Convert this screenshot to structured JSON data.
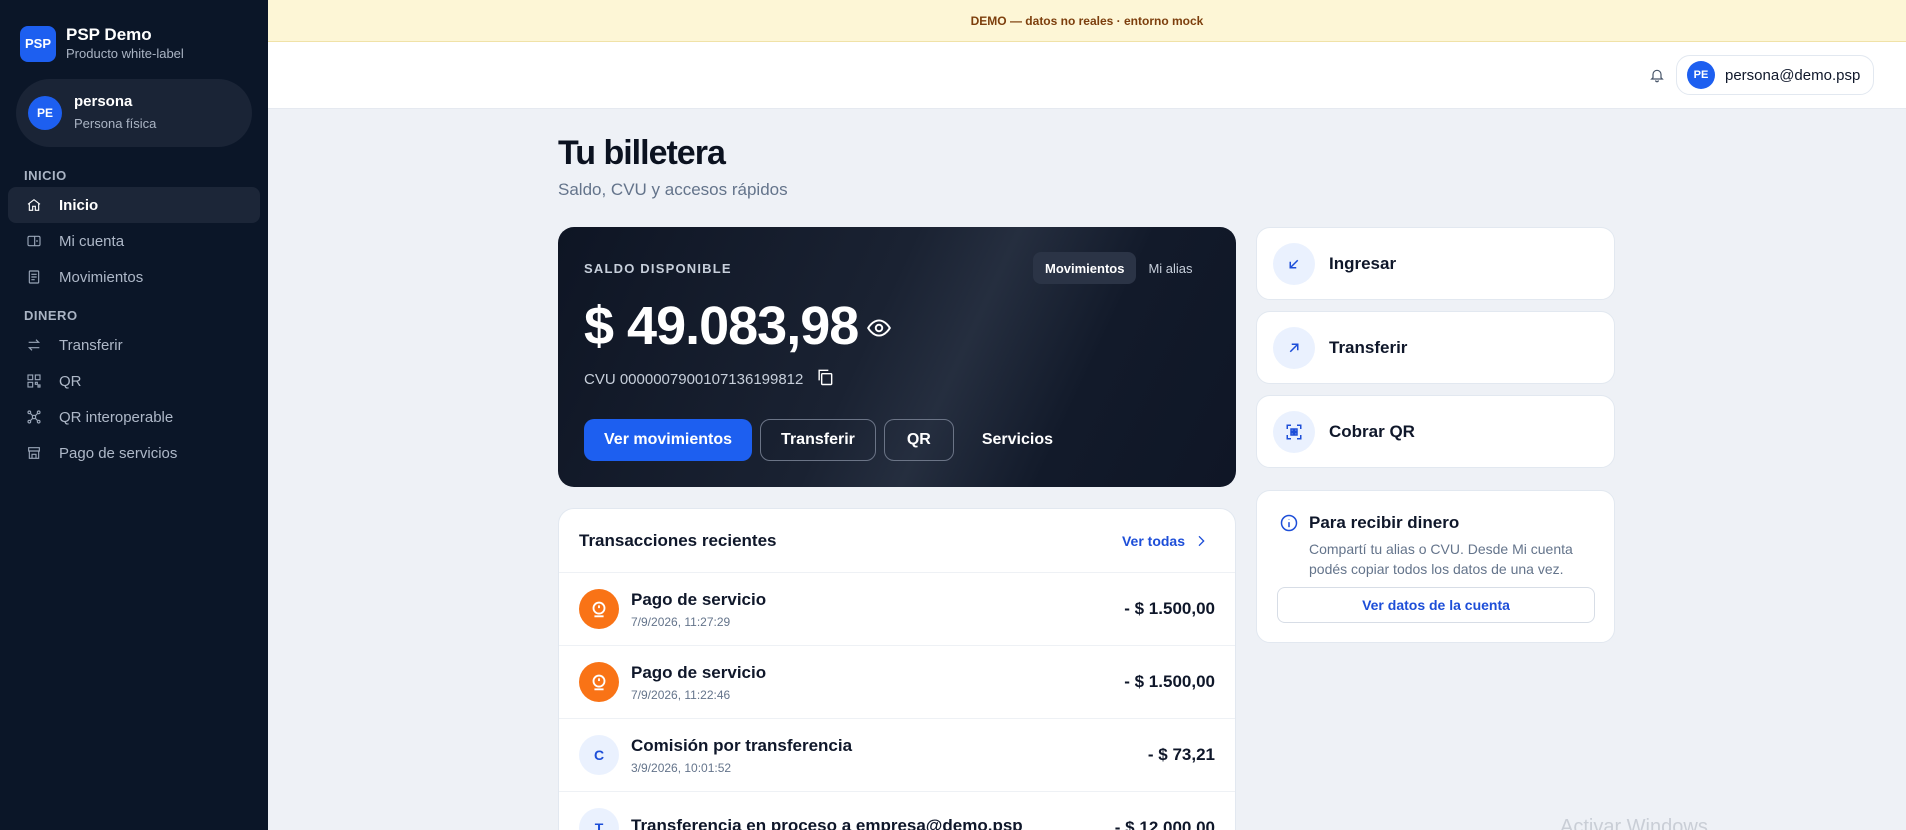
{
  "brand": {
    "logo": "PSP",
    "title": "PSP Demo",
    "subtitle": "Producto white-label"
  },
  "user": {
    "initials": "PE",
    "name": "persona",
    "role": "Persona física",
    "email": "persona@demo.psp"
  },
  "nav": {
    "section_inicio": "INICIO",
    "section_dinero": "DINERO",
    "items": [
      {
        "label": "Inicio",
        "icon": "home-icon",
        "active": true
      },
      {
        "label": "Mi cuenta",
        "icon": "wallet-icon"
      },
      {
        "label": "Movimientos",
        "icon": "receipt-icon"
      },
      {
        "label": "Transferir",
        "icon": "arrows-exchange-icon"
      },
      {
        "label": "QR",
        "icon": "qr-icon"
      },
      {
        "label": "QR interoperable",
        "icon": "network-icon"
      },
      {
        "label": "Pago de servicios",
        "icon": "store-icon"
      }
    ]
  },
  "banner": {
    "text": "DEMO — datos no reales · entorno mock"
  },
  "header": {
    "title": "Tu billetera",
    "subtitle": "Saldo, CVU y accesos rápidos"
  },
  "balance": {
    "label": "SALDO DISPONIBLE",
    "amount": "$ 49.083,98",
    "cvu": "CVU 0000007900107136199812",
    "tabs": [
      "Movimientos",
      "Mi alias"
    ],
    "actions": [
      "Ver movimientos",
      "Transferir",
      "QR",
      "Servicios"
    ]
  },
  "transactions": {
    "title": "Transacciones recientes",
    "see_all": "Ver todas",
    "rows": [
      {
        "icon": "service-icon",
        "title": "Pago de servicio",
        "date": "7/9/2026, 11:27:29",
        "amount": "- $ 1.500,00"
      },
      {
        "icon": "service-icon",
        "title": "Pago de servicio",
        "date": "7/9/2026, 11:22:46",
        "amount": "- $ 1.500,00"
      },
      {
        "letter": "C",
        "title": "Comisión por transferencia",
        "date": "3/9/2026, 10:01:52",
        "amount": "- $ 73,21"
      },
      {
        "letter": "T",
        "title": "Transferencia en proceso a empresa@demo.psp",
        "date": "",
        "amount": "- $ 12.000,00"
      }
    ]
  },
  "quick_actions": [
    {
      "label": "Ingresar",
      "icon": "arrow-down-left-icon"
    },
    {
      "label": "Transferir",
      "icon": "arrow-up-right-icon"
    },
    {
      "label": "Cobrar QR",
      "icon": "qr-scan-icon"
    }
  ],
  "info": {
    "title": "Para recibir dinero",
    "text": "Compartí tu alias o CVU. Desde Mi cuenta podés copiar todos los datos de una vez.",
    "button": "Ver datos de la cuenta"
  },
  "watermark": "Activar Windows",
  "colors": {
    "primary": "#1d5ff0",
    "sidebar": "#0b1628",
    "banner": "#fdf6d6",
    "service_orange": "#f97316"
  }
}
